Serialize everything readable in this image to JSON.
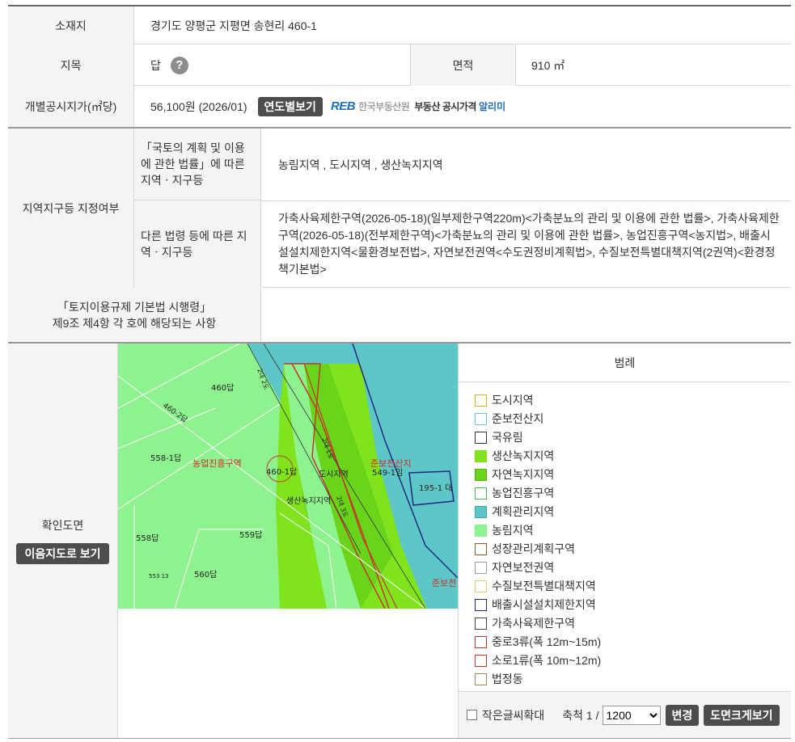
{
  "parcel": {
    "location_label": "소재지",
    "location_value": "경기도 양평군 지평면 송현리 460-1",
    "jimok_label": "지목",
    "jimok_value": "답",
    "help_glyph": "?",
    "area_label": "면적",
    "area_value": "910 ㎡",
    "price_label": "개별공시지가(㎡당)",
    "price_value": "56,100원 (2026/01)",
    "by_year_button": "연도별보기",
    "reb_logo": {
      "mark": "REB",
      "org": "한국부동산원",
      "service": "부동산 공시가격",
      "service_accent": "알리미"
    }
  },
  "zoning": {
    "group_label": "지역지구등 지정여부",
    "national_law_label": "「국토의 계획 및 이용에 관한 법률」에 따른 지역ㆍ지구등",
    "national_law_value": "농림지역 , 도시지역 , 생산녹지지역",
    "other_law_label": "다른 법령 등에 따른 지역ㆍ지구등",
    "other_law_value": "가축사육제한구역(2026-05-18)(일부제한구역220m)<가축분뇨의 관리 및 이용에 관한 법률>, 가축사육제한구역(2026-05-18)(전부제한구역)<가축분뇨의 관리 및 이용에 관한 법률>, 농업진흥구역<농지법>, 배출시설설치제한지역<물환경보전법>, 자연보전권역<수도권정비계획법>, 수질보전특별대책지역(2권역)<환경정책기본법>",
    "enforcement_label_line1": "「토지이용규제 기본법 시행령」",
    "enforcement_label_line2": "제9조 제4항 각 호에 해당되는 사항",
    "enforcement_value": ""
  },
  "map_section": {
    "label": "확인도면",
    "view_button": "이음지도로 보기",
    "map_labels": {
      "p460": "460답",
      "p460_2": "460-2답",
      "p558_1": "558-1답",
      "zone_agri": "농업진흥구역",
      "p460_1": "460-1답",
      "urban": "도시지역",
      "semi_cons": "준보전산지",
      "p549_1": "549-1임",
      "p195_1": "195-1 대",
      "prod_green": "생산녹지지역",
      "p558": "558답",
      "p559": "559답",
      "p560": "560답",
      "semi_cons_2": "준보전",
      "road1": "2대 2도",
      "road2": "2대 1도",
      "road3": "2대 3도",
      "tiny": "553 13"
    },
    "legend_title": "범례",
    "legend": [
      {
        "label": "도시지역",
        "fill": "#ffffff",
        "border": "#d4b21d"
      },
      {
        "label": "준보전산지",
        "fill": "#ffffff",
        "border": "#6cc7cb"
      },
      {
        "label": "국유림",
        "fill": "#ffffff",
        "border": "#333333"
      },
      {
        "label": "생산녹지지역",
        "fill": "#7fe31d",
        "border": "#7fe31d"
      },
      {
        "label": "자연녹지지역",
        "fill": "#6ad41a",
        "border": "#59b012"
      },
      {
        "label": "농업진흥구역",
        "fill": "#ffffff",
        "border": "#4caf50"
      },
      {
        "label": "계획관리지역",
        "fill": "#5dc6c6",
        "border": "#3fa9a9"
      },
      {
        "label": "농림지역",
        "fill": "#8ef28e",
        "border": "#8ef28e"
      },
      {
        "label": "성장관리계획구역",
        "fill": "#ffffff",
        "border": "#8a5a2b"
      },
      {
        "label": "자연보전권역",
        "fill": "#ffffff",
        "border": "#999999"
      },
      {
        "label": "수질보전특별대책지역",
        "fill": "#ffffff",
        "border": "#d9cf7a"
      },
      {
        "label": "배출시설설치제한지역",
        "fill": "#ffffff",
        "border": "#1b2a80"
      },
      {
        "label": "가축사육제한구역",
        "fill": "#ffffff",
        "border": "#444444"
      },
      {
        "label": "중로3류(폭 12m~15m)",
        "fill": "#ffffff",
        "border": "#c0392b"
      },
      {
        "label": "소로1류(폭 10m~12m)",
        "fill": "#ffffff",
        "border": "#c0392b"
      },
      {
        "label": "법정동",
        "fill": "#ffffff",
        "border": "#9a8a5a"
      }
    ],
    "small_text_label": "작은글씨확대",
    "scale_label": "축척 1 /",
    "scale_value": "1200",
    "change_button": "변경",
    "large_map_button": "도면크게보기"
  }
}
